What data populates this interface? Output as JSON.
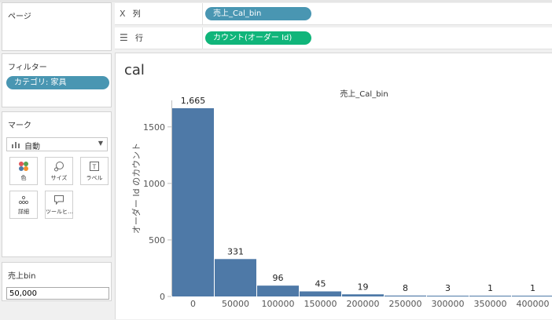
{
  "pages_panel": {
    "title": "ページ"
  },
  "filters_panel": {
    "title": "フィルター",
    "pill": "カテゴリ: 家具"
  },
  "marks_panel": {
    "title": "マーク",
    "mark_type": "自動",
    "buttons": {
      "color": "色",
      "size": "サイズ",
      "label": "ラベル",
      "detail": "詳細",
      "tooltip": "ツールヒ…"
    }
  },
  "param_panel": {
    "title": "売上bin",
    "value": "50,000"
  },
  "shelves": {
    "columns_label": "列",
    "columns_pill": "売上_Cal_bin",
    "rows_label": "行",
    "rows_pill": "カウント(オーダー Id)"
  },
  "colors": {
    "bar": "#4e79a7",
    "blue_pill": "#4996b2",
    "green_pill": "#10b57a"
  },
  "sheet": {
    "title": "cal"
  },
  "chart_data": {
    "type": "bar",
    "title": "売上_Cal_bin",
    "xlabel": "",
    "ylabel": "オーダー Id のカウント",
    "categories": [
      "0",
      "50000",
      "100000",
      "150000",
      "200000",
      "250000",
      "300000",
      "350000",
      "400000"
    ],
    "values": [
      1665,
      331,
      96,
      45,
      19,
      8,
      3,
      1,
      1
    ],
    "data_labels": [
      "1,665",
      "331",
      "96",
      "45",
      "19",
      "8",
      "3",
      "1",
      "1"
    ],
    "yticks": [
      "0",
      "500",
      "1000",
      "1500"
    ],
    "ylim": [
      0,
      1850
    ],
    "grid": false
  }
}
